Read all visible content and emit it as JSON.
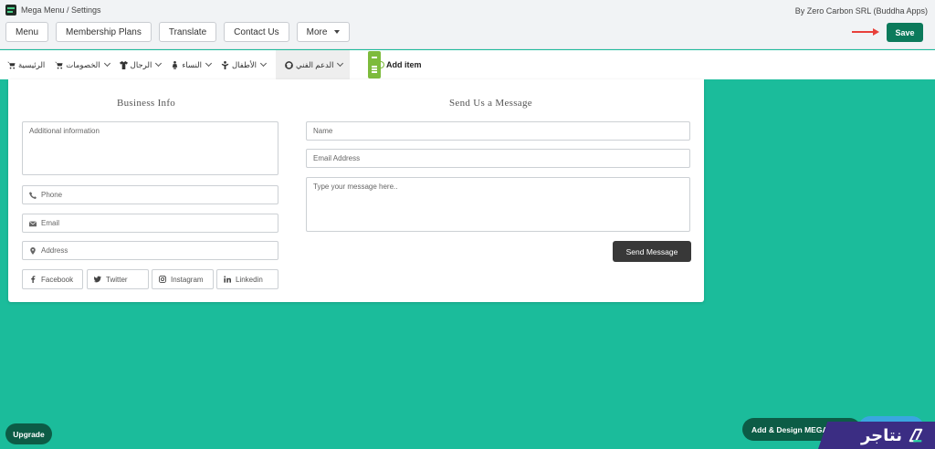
{
  "header": {
    "breadcrumb": "Mega Menu / Settings",
    "byline": "By Zero Carbon SRL (Buddha Apps)",
    "tabs": [
      "Menu",
      "Membership Plans",
      "Translate",
      "Contact Us"
    ],
    "more_label": "More",
    "save_label": "Save"
  },
  "menubar": {
    "items": [
      "الرئيسية",
      "الخصومات",
      "الرجال",
      "النساء",
      "الأطفال",
      "الدعم الفني"
    ],
    "add_item_label": "Add item"
  },
  "panel": {
    "business_info": {
      "title": "Business Info",
      "additional_placeholder": "Additional information",
      "phone_placeholder": "Phone",
      "email_placeholder": "Email",
      "address_placeholder": "Address",
      "socials": [
        "Facebook",
        "Twitter",
        "Instagram",
        "Linkedin"
      ]
    },
    "message": {
      "title": "Send Us a Message",
      "name_placeholder": "Name",
      "email_placeholder": "Email Address",
      "message_placeholder": "Type your message here..",
      "send_label": "Send Message"
    }
  },
  "footer": {
    "upgrade_label": "Upgrade",
    "add_design_label": "Add & Design MEGA",
    "brand_text": "نتاجر"
  },
  "colors": {
    "accent": "#1bbc9b",
    "save": "#0c7a5b",
    "dark_green": "#0c5c46",
    "brand_purple": "#3b2d83",
    "add_tile": "#7dbb3c"
  }
}
